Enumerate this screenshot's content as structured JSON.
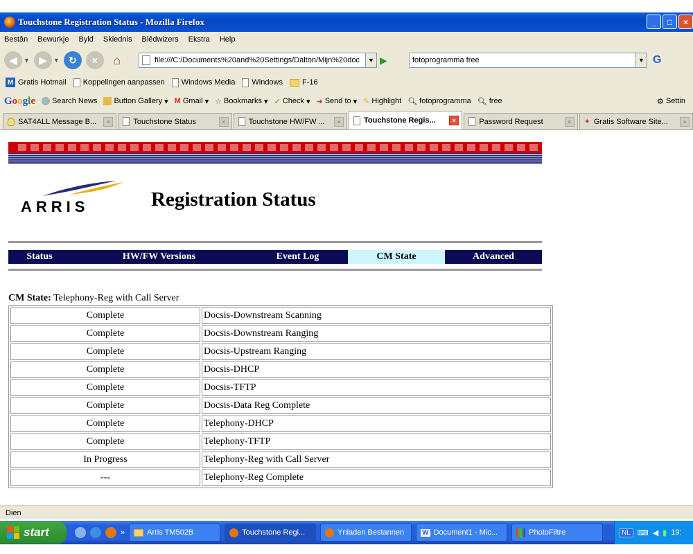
{
  "window": {
    "title": "Touchstone Registration Status - Mozilla Firefox"
  },
  "menu": [
    "Bestân",
    "Bewurkje",
    "Byld",
    "Skiednis",
    "Blêdwizers",
    "Ekstra",
    "Help"
  ],
  "nav": {
    "url": "file:///C:/Documents%20and%20Settings/Dalton/Mijn%20doc",
    "search": "fotoprogramma free"
  },
  "bookmarks": [
    "Gratis Hotmail",
    "Koppelingen aanpassen",
    "Windows Media",
    "Windows",
    "F-16"
  ],
  "google_toolbar": {
    "logo": "Google",
    "items": [
      "Search News",
      "Button Gallery",
      "Gmail",
      "Bookmarks",
      "Check",
      "Send to",
      "Highlight",
      "fotoprogramma",
      "free",
      "Settin"
    ]
  },
  "tabs": [
    {
      "label": "SAT4ALL Message B...",
      "active": false
    },
    {
      "label": "Touchstone Status",
      "active": false
    },
    {
      "label": "Touchstone HW/FW ...",
      "active": false
    },
    {
      "label": "Touchstone Regis...",
      "active": true
    },
    {
      "label": "Password Request",
      "active": false
    },
    {
      "label": "Gratis Software Site...",
      "active": false
    }
  ],
  "page": {
    "logo_text": "ARRIS",
    "title": "Registration Status",
    "nav_tabs": [
      {
        "label": "Status",
        "active": false
      },
      {
        "label": "HW/FW Versions",
        "active": false
      },
      {
        "label": "Event Log",
        "active": false
      },
      {
        "label": "CM State",
        "active": true
      },
      {
        "label": "Advanced",
        "active": false
      }
    ],
    "cm_state_label": "CM State:",
    "cm_state_value": "Telephony-Reg with Call Server",
    "states": [
      {
        "status": "Complete",
        "step": "Docsis-Downstream Scanning"
      },
      {
        "status": "Complete",
        "step": "Docsis-Downstream Ranging"
      },
      {
        "status": "Complete",
        "step": "Docsis-Upstream Ranging"
      },
      {
        "status": "Complete",
        "step": "Docsis-DHCP"
      },
      {
        "status": "Complete",
        "step": "Docsis-TFTP"
      },
      {
        "status": "Complete",
        "step": "Docsis-Data Reg Complete"
      },
      {
        "status": "Complete",
        "step": "Telephony-DHCP"
      },
      {
        "status": "Complete",
        "step": "Telephony-TFTP"
      },
      {
        "status": "In Progress",
        "step": "Telephony-Reg with Call Server"
      },
      {
        "status": "---",
        "step": "Telephony-Reg Complete"
      }
    ]
  },
  "status_bar": "Dien",
  "taskbar": {
    "start": "start",
    "buttons": [
      {
        "label": "Arris TM502B",
        "active": false
      },
      {
        "label": "Touchstone Regi...",
        "active": true
      },
      {
        "label": "Ynladen Bestannen",
        "active": false
      },
      {
        "label": "Document1 - Mic...",
        "active": false
      },
      {
        "label": "PhotoFiltre",
        "active": false
      }
    ],
    "lang": "NL",
    "clock": "19:"
  },
  "colors": {
    "navy": "#0b0b55",
    "active_tab": "#ccf6fb",
    "banner_red": "#cc0000"
  }
}
